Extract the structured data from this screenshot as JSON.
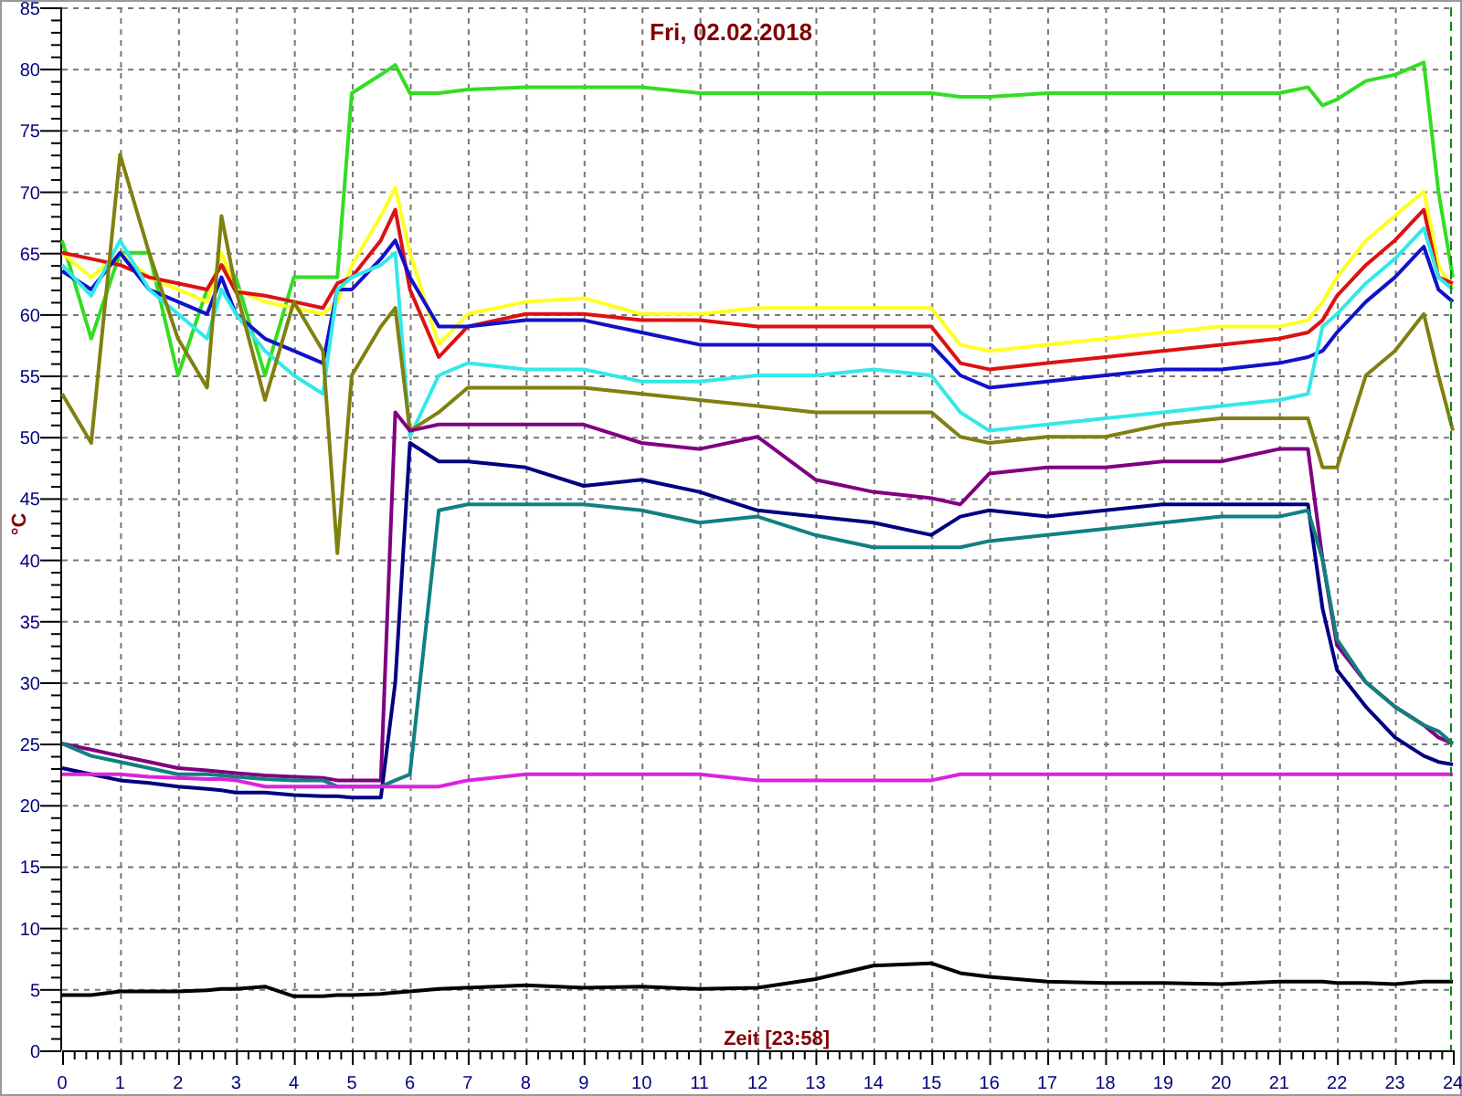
{
  "chart": {
    "chart_data": {
      "type": "line",
      "title": "Fri, 02.02.2018",
      "xlabel": "Zeit [23:58]",
      "ylabel": "°C",
      "x": [
        0,
        0.5,
        1,
        1.5,
        2,
        2.5,
        2.75,
        3,
        3.5,
        4,
        4.5,
        4.75,
        5,
        5.5,
        5.75,
        6,
        6.5,
        7,
        8,
        9,
        10,
        11,
        12,
        13,
        14,
        15,
        15.5,
        16,
        17,
        18,
        19,
        20,
        21,
        21.5,
        21.75,
        22,
        22.5,
        23,
        23.5,
        23.75,
        24
      ],
      "series": [
        {
          "color": "#33dd22",
          "values": [
            66,
            58,
            65,
            65,
            55,
            62,
            64,
            63,
            55,
            63,
            63,
            63,
            78,
            79.5,
            80.3,
            78,
            78,
            78.3,
            78.5,
            78.5,
            78.5,
            78,
            78,
            78,
            78,
            78,
            77.7,
            77.7,
            78,
            78,
            78,
            78,
            78,
            78.5,
            77,
            77.5,
            79,
            79.5,
            80.5,
            70,
            63
          ]
        },
        {
          "color": "#ffff22",
          "values": [
            65,
            63,
            65,
            63,
            62,
            61,
            65,
            62,
            61,
            60.5,
            60,
            61,
            64,
            68,
            70.3,
            65,
            57.5,
            60,
            61,
            61.3,
            60,
            60,
            60.5,
            60.5,
            60.5,
            60.5,
            57.5,
            57,
            57.5,
            58,
            58.5,
            59,
            59,
            59.5,
            61,
            63,
            66,
            68,
            70,
            64,
            62
          ]
        },
        {
          "color": "#dd1111",
          "values": [
            65,
            64.5,
            64,
            63,
            62.5,
            62,
            64,
            61.8,
            61.5,
            61,
            60.5,
            62.5,
            63,
            66,
            68.5,
            62,
            56.5,
            59,
            60,
            60,
            59.5,
            59.5,
            59,
            59,
            59,
            59,
            56,
            55.5,
            56,
            56.5,
            57,
            57.5,
            58,
            58.5,
            59.5,
            61.5,
            64,
            66,
            68.5,
            63,
            62.5
          ]
        },
        {
          "color": "#1111cc",
          "values": [
            63.5,
            62,
            65,
            62,
            61,
            60,
            63,
            60,
            58,
            57,
            56,
            62,
            62,
            64.5,
            66,
            63,
            59,
            59,
            59.5,
            59.5,
            58.5,
            57.5,
            57.5,
            57.5,
            57.5,
            57.5,
            55,
            54,
            54.5,
            55,
            55.5,
            55.5,
            56,
            56.5,
            57,
            58.5,
            61,
            63,
            65.5,
            62,
            61
          ]
        },
        {
          "color": "#33e8e8",
          "values": [
            64,
            61.5,
            66,
            62,
            60,
            58,
            62,
            60,
            57,
            55,
            53.5,
            62,
            63,
            64,
            65,
            50,
            55,
            56,
            55.5,
            55.5,
            54.5,
            54.5,
            55,
            55,
            55.5,
            55,
            52,
            50.5,
            51,
            51.5,
            52,
            52.5,
            53,
            53.5,
            59,
            60,
            62.5,
            64.5,
            67,
            63,
            62
          ]
        },
        {
          "color": "#808010",
          "values": [
            53.5,
            49.5,
            73,
            65,
            58,
            54,
            68,
            62,
            53,
            61,
            57,
            40.5,
            55,
            59,
            60.5,
            50.5,
            52,
            54,
            54,
            54,
            53.5,
            53,
            52.5,
            52,
            52,
            52,
            50,
            49.5,
            50,
            50,
            51,
            51.5,
            51.5,
            51.5,
            47.5,
            47.5,
            55,
            57,
            60,
            55,
            50.5
          ]
        },
        {
          "color": "#800080",
          "values": [
            25,
            24.5,
            24,
            23.5,
            23,
            22.8,
            22.7,
            22.6,
            22.4,
            22.3,
            22.2,
            22,
            22,
            22,
            52,
            50.5,
            51,
            51,
            51,
            51,
            49.5,
            49,
            50,
            46.5,
            45.5,
            45,
            44.5,
            47,
            47.5,
            47.5,
            48,
            48,
            49,
            49,
            40,
            33,
            30,
            28,
            26.5,
            25.5,
            25
          ]
        },
        {
          "color": "#000080",
          "values": [
            23,
            22.5,
            22,
            21.8,
            21.5,
            21.3,
            21.2,
            21,
            21,
            20.8,
            20.7,
            20.7,
            20.6,
            20.6,
            30,
            49.5,
            48,
            48,
            47.5,
            46,
            46.5,
            45.5,
            44,
            43.5,
            43,
            42,
            43.5,
            44,
            43.5,
            44,
            44.5,
            44.5,
            44.5,
            44.5,
            36,
            31,
            28,
            25.5,
            24,
            23.5,
            23.3
          ]
        },
        {
          "color": "#108080",
          "values": [
            25,
            24,
            23.5,
            23,
            22.5,
            22.5,
            22.4,
            22.3,
            22.1,
            22,
            22,
            21.5,
            21.5,
            21.5,
            22,
            22.5,
            44,
            44.5,
            44.5,
            44.5,
            44,
            43,
            43.5,
            42,
            41,
            41,
            41,
            41.5,
            42,
            42.5,
            43,
            43.5,
            43.5,
            44,
            40,
            33.5,
            30,
            28,
            26.5,
            26,
            25
          ]
        },
        {
          "color": "#dd22dd",
          "values": [
            22.5,
            22.5,
            22.5,
            22.3,
            22.2,
            22.1,
            22.1,
            22,
            21.5,
            21.5,
            21.5,
            21.5,
            21.5,
            21.5,
            21.5,
            21.5,
            21.5,
            22,
            22.5,
            22.5,
            22.5,
            22.5,
            22,
            22,
            22,
            22,
            22.5,
            22.5,
            22.5,
            22.5,
            22.5,
            22.5,
            22.5,
            22.5,
            22.5,
            22.5,
            22.5,
            22.5,
            22.5,
            22.5,
            22.5
          ]
        },
        {
          "color": "#000000",
          "values": [
            4.5,
            4.5,
            4.8,
            4.8,
            4.8,
            4.9,
            5,
            5,
            5.2,
            4.4,
            4.4,
            4.5,
            4.5,
            4.6,
            4.7,
            4.8,
            5,
            5.1,
            5.3,
            5.1,
            5.2,
            5,
            5.1,
            5.8,
            6.9,
            7.1,
            6.3,
            6,
            5.6,
            5.5,
            5.5,
            5.4,
            5.6,
            5.6,
            5.6,
            5.5,
            5.5,
            5.4,
            5.6,
            5.6,
            5.6
          ]
        }
      ],
      "xlim": [
        0,
        24
      ],
      "ylim": [
        0,
        85
      ],
      "grid": true,
      "xticks": [
        0,
        1,
        2,
        3,
        4,
        5,
        6,
        7,
        8,
        9,
        10,
        11,
        12,
        13,
        14,
        15,
        16,
        17,
        18,
        19,
        20,
        21,
        22,
        23,
        24
      ],
      "yticks": [
        0,
        5,
        10,
        15,
        20,
        25,
        30,
        35,
        40,
        45,
        50,
        55,
        60,
        65,
        70,
        75,
        80,
        85
      ]
    }
  }
}
